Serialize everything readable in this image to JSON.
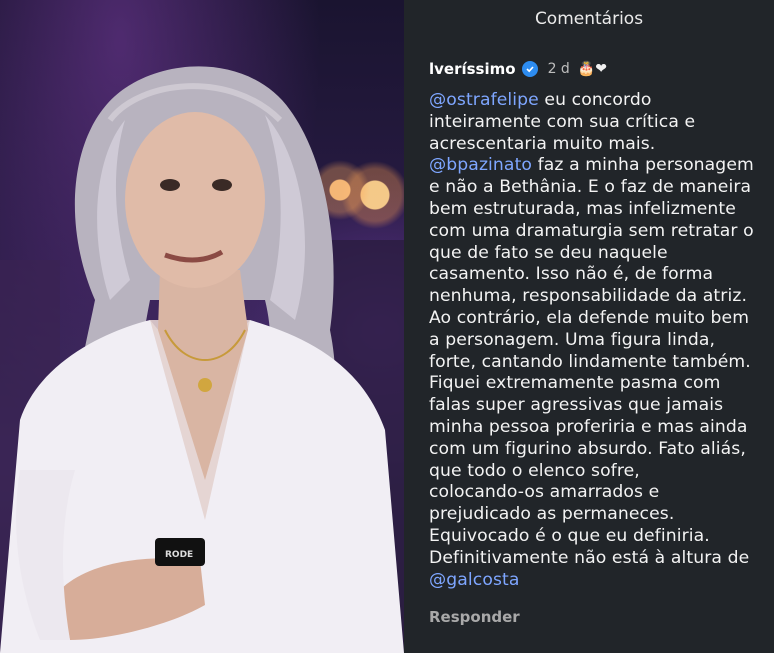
{
  "panel": {
    "title": "Comentários",
    "comment": {
      "username": "lveríssimo",
      "verified_icon": "verified-badge-icon",
      "time": "2 d",
      "emoji": "🎂❤",
      "lines": [
        [
          {
            "t": "@ostrafelipe",
            "m": true
          },
          {
            "t": " eu concordo",
            "m": false
          }
        ],
        [
          {
            "t": "inteiramente com sua crítica e",
            "m": false
          }
        ],
        [
          {
            "t": "acrescentaria muito mais.",
            "m": false
          }
        ],
        [
          {
            "t": "@bpazinato",
            "m": true
          },
          {
            "t": " faz a minha personagem",
            "m": false
          }
        ],
        [
          {
            "t": "e não a Bethânia. E o faz de maneira",
            "m": false
          }
        ],
        [
          {
            "t": "bem estruturada, mas infelizmente",
            "m": false
          }
        ],
        [
          {
            "t": "com uma dramaturgia sem retratar o",
            "m": false
          }
        ],
        [
          {
            "t": "que de fato se deu naquele",
            "m": false
          }
        ],
        [
          {
            "t": "casamento. Isso não é, de forma",
            "m": false
          }
        ],
        [
          {
            "t": "nenhuma, responsabilidade da atriz.",
            "m": false
          }
        ],
        [
          {
            "t": "Ao contrário, ela defende muito bem",
            "m": false
          }
        ],
        [
          {
            "t": "a personagem. Uma figura linda,",
            "m": false
          }
        ],
        [
          {
            "t": "forte, cantando lindamente também.",
            "m": false
          }
        ],
        [
          {
            "t": "Fiquei extremamente pasma com",
            "m": false
          }
        ],
        [
          {
            "t": "falas super agressivas que jamais",
            "m": false
          }
        ],
        [
          {
            "t": "minha pessoa proferiria e mas ainda",
            "m": false
          }
        ],
        [
          {
            "t": "com um figurino absurdo. Fato aliás,",
            "m": false
          }
        ],
        [
          {
            "t": "que todo o elenco sofre,",
            "m": false
          }
        ],
        [
          {
            "t": "colocando-os amarrados e",
            "m": false
          }
        ],
        [
          {
            "t": "prejudicado as permaneces.",
            "m": false
          }
        ],
        [
          {
            "t": "Equivocado é o que eu definiria.",
            "m": false
          }
        ],
        [
          {
            "t": "Definitivamente não está à altura de",
            "m": false
          }
        ],
        [
          {
            "t": "@galcosta",
            "m": true
          }
        ]
      ],
      "reply_label": "Responder"
    }
  },
  "photo": {
    "microphone_label": "RODE"
  },
  "colors": {
    "panel_bg": "#212529",
    "mention": "#7ea6ff",
    "verified": "#2d8cf0"
  }
}
